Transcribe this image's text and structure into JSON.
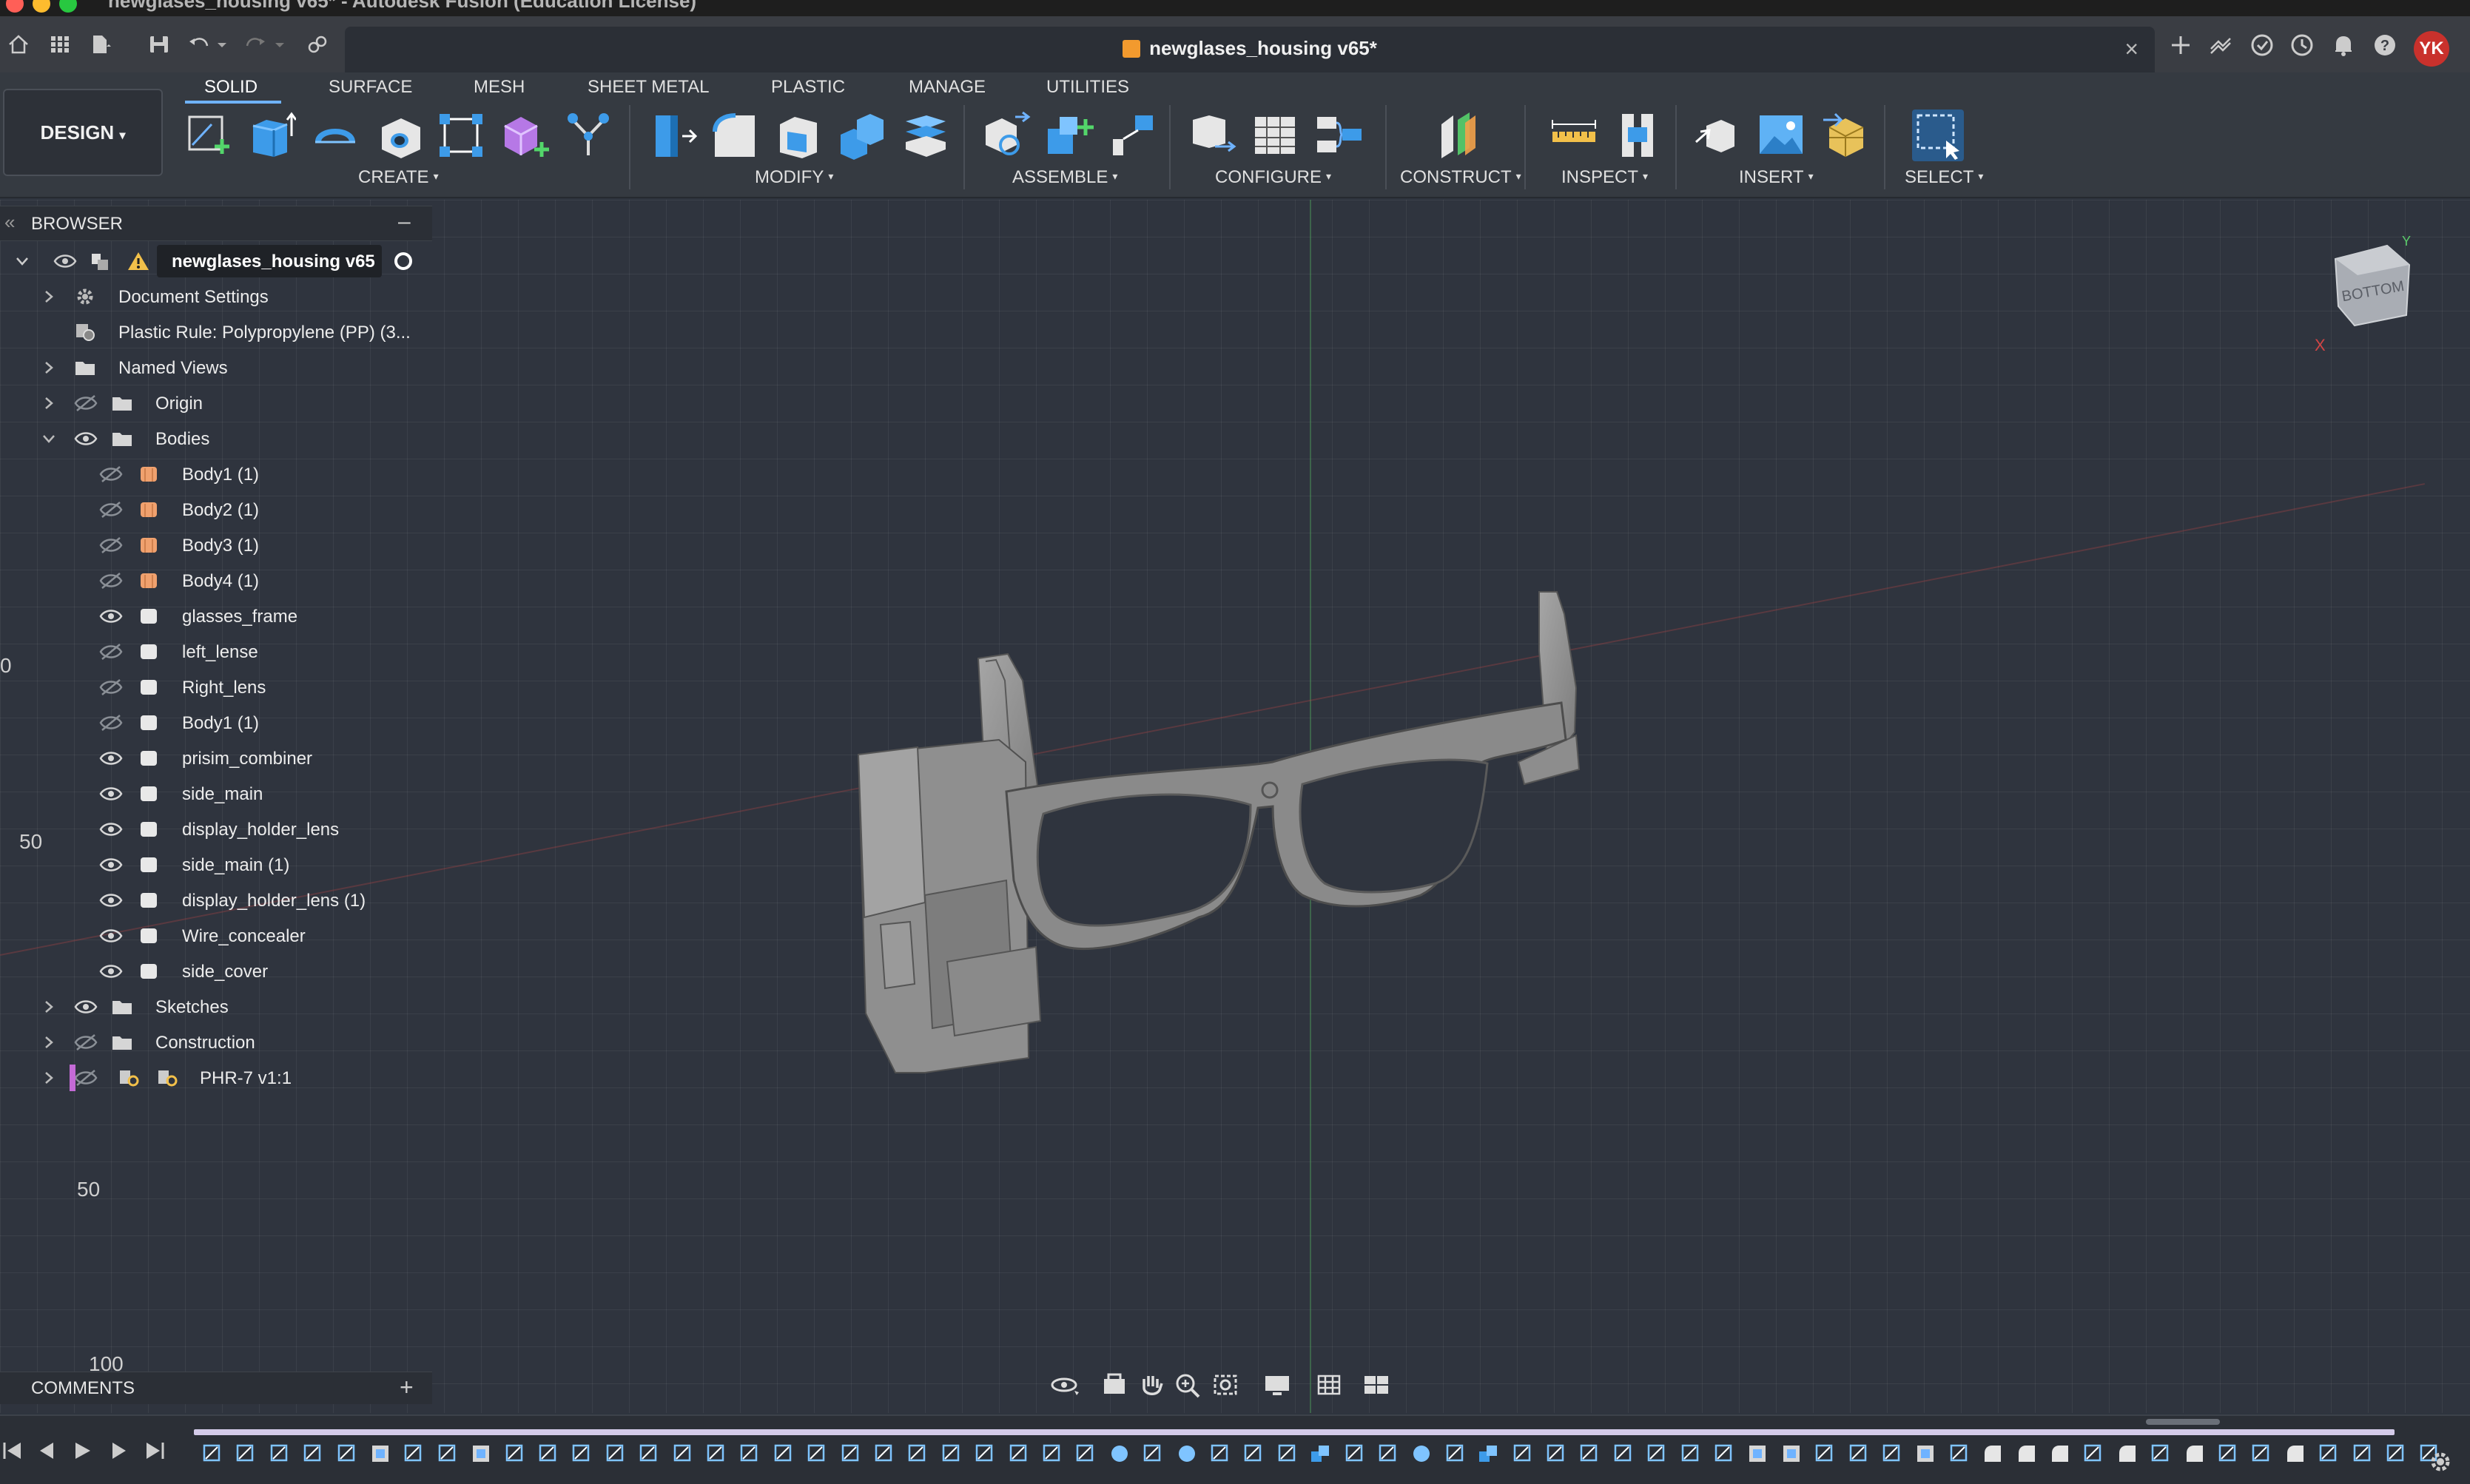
{
  "window": {
    "title": "newglases_housing v65* - Autodesk Fusion (Education License)",
    "traffic_colors": [
      "#ff5f57",
      "#febc2e",
      "#28c840"
    ]
  },
  "document_tab": {
    "label": "newglases_housing v65*",
    "close": "×",
    "icon": "orange-cube-icon"
  },
  "user": {
    "initials": "YK",
    "color": "#c9312c"
  },
  "toolbar": {
    "workspace": "DESIGN",
    "workspace_caret": "▾",
    "tabs": [
      "SOLID",
      "SURFACE",
      "MESH",
      "SHEET METAL",
      "PLASTIC",
      "MANAGE",
      "UTILITIES"
    ],
    "active_tab": "SOLID",
    "groups": [
      "CREATE",
      "MODIFY",
      "ASSEMBLE",
      "CONFIGURE",
      "CONSTRUCT",
      "INSPECT",
      "INSERT",
      "SELECT"
    ],
    "accent": "#6fb3ff"
  },
  "browser": {
    "title": "BROWSER",
    "collapse": "–",
    "root": "newglases_housing v65",
    "items": [
      {
        "label": "Document Settings",
        "icon": "gear-icon"
      },
      {
        "label": "Plastic Rule: Polypropylene (PP) (3...",
        "icon": "plastic-rule-icon"
      },
      {
        "label": "Named Views",
        "icon": "folder-icon"
      },
      {
        "label": "Origin",
        "icon": "folder-icon"
      },
      {
        "label": "Bodies",
        "icon": "folder-icon"
      },
      {
        "label": "Body1 (1)",
        "icon": "body-icon"
      },
      {
        "label": "Body2 (1)",
        "icon": "body-icon"
      },
      {
        "label": "Body3 (1)",
        "icon": "body-icon"
      },
      {
        "label": "Body4 (1)",
        "icon": "body-icon"
      },
      {
        "label": "glasses_frame",
        "icon": "body-icon"
      },
      {
        "label": "left_lense",
        "icon": "body-icon"
      },
      {
        "label": "Right_lens",
        "icon": "body-icon"
      },
      {
        "label": "Body1 (1)",
        "icon": "body-icon"
      },
      {
        "label": "prisim_combiner",
        "icon": "body-icon"
      },
      {
        "label": "side_main",
        "icon": "body-icon"
      },
      {
        "label": "display_holder_lens",
        "icon": "body-icon"
      },
      {
        "label": "side_main (1)",
        "icon": "body-icon"
      },
      {
        "label": "display_holder_lens (1)",
        "icon": "body-icon"
      },
      {
        "label": "Wire_concealer",
        "icon": "body-icon"
      },
      {
        "label": "side_cover",
        "icon": "body-icon"
      },
      {
        "label": "Sketches",
        "icon": "folder-icon"
      },
      {
        "label": "Construction",
        "icon": "folder-icon"
      },
      {
        "label": "PHR-7 v1:1",
        "icon": "linked-component-icon"
      }
    ]
  },
  "viewport": {
    "ruler_labels": [
      "0",
      "50",
      "50",
      "100"
    ],
    "viewcube_face": "BOTTOM",
    "axis_x": "X",
    "axis_y": "Y"
  },
  "comments": {
    "title": "COMMENTS",
    "add": "+"
  }
}
